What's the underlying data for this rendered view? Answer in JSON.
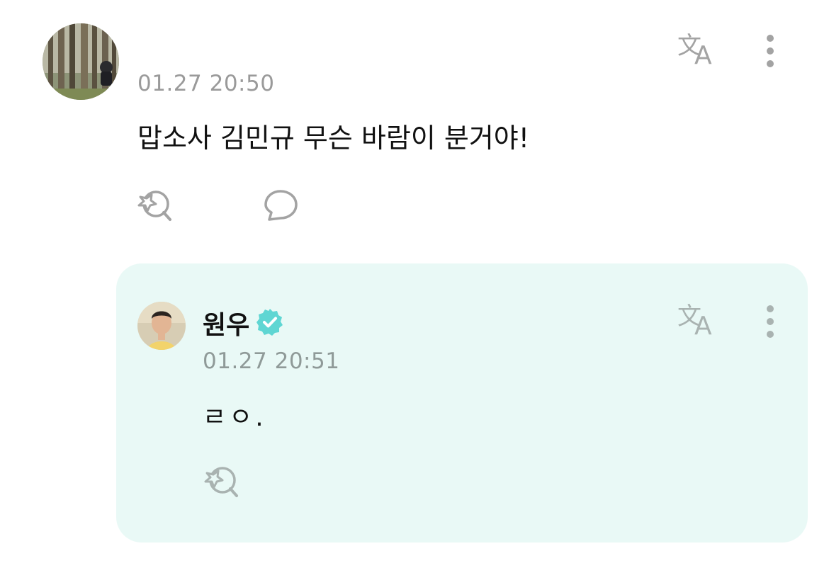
{
  "comment": {
    "avatar_icon": "user-avatar-forest-photo",
    "timestamp": "01.27 20:50",
    "text": "맙소사 김민규 무슨 바람이 분거야!",
    "translate_icon": "translate-icon",
    "more_icon": "more-vertical-icon",
    "reaction_icon": "add-reaction-icon",
    "reply_icon": "reply-bubble-icon"
  },
  "reply": {
    "author": "원우",
    "verified": true,
    "verified_icon": "verified-badge-icon",
    "timestamp": "01.27 20:51",
    "text": "ㄹㅇ.",
    "translate_icon": "translate-icon",
    "more_icon": "more-vertical-icon",
    "reaction_icon": "add-reaction-icon"
  },
  "colors": {
    "reply_background": "#e9f9f6",
    "verified_badge": "#5fd6d3",
    "timestamp_gray": "#9a9a9a",
    "icon_gray": "#a0a0a0"
  }
}
